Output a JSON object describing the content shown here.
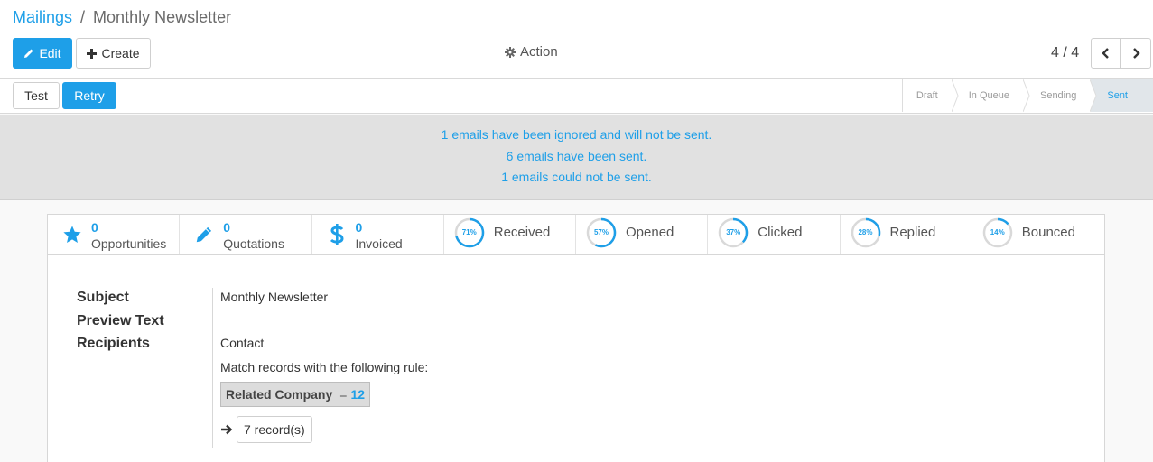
{
  "breadcrumb": {
    "parent": "Mailings",
    "separator": "/",
    "current": "Monthly Newsletter"
  },
  "toolbar": {
    "edit_label": "Edit",
    "create_label": "Create",
    "action_label": "Action"
  },
  "pager": {
    "counter": "4 / 4"
  },
  "statusbar": {
    "test_label": "Test",
    "retry_label": "Retry",
    "stages": [
      "Draft",
      "In Queue",
      "Sending",
      "Sent"
    ],
    "active_stage": "Sent"
  },
  "alerts": {
    "ignored": "1  emails have been ignored and will not be sent.",
    "sent": "6  emails have been sent.",
    "failed": "1  emails could not be sent."
  },
  "stats": {
    "opportunities": {
      "value": "0",
      "label": "Opportunities",
      "icon": "star-icon"
    },
    "quotations": {
      "value": "0",
      "label": "Quotations",
      "icon": "pencil-icon"
    },
    "invoiced": {
      "value": "0",
      "label": "Invoiced",
      "icon": "dollar-icon"
    },
    "received": {
      "pct": "71%",
      "fraction": 0.71,
      "label": "Received"
    },
    "opened": {
      "pct": "57%",
      "fraction": 0.57,
      "label": "Opened"
    },
    "clicked": {
      "pct": "37%",
      "fraction": 0.37,
      "label": "Clicked"
    },
    "replied": {
      "pct": "28%",
      "fraction": 0.28,
      "label": "Replied"
    },
    "bounced": {
      "pct": "14%",
      "fraction": 0.14,
      "label": "Bounced"
    }
  },
  "form": {
    "subject_label": "Subject",
    "subject_value": "Monthly Newsletter",
    "preview_label": "Preview Text",
    "recipients_label": "Recipients",
    "recipients_value": "Contact",
    "rule_text": "Match records with the following rule:",
    "domain_field": "Related Company",
    "domain_operator": "=",
    "domain_value": "12",
    "records_label": "7 record(s)"
  },
  "colors": {
    "accent": "#1e9fe8",
    "alert_bg": "#e1e1e1",
    "gauge_track": "#d9d9d9"
  }
}
